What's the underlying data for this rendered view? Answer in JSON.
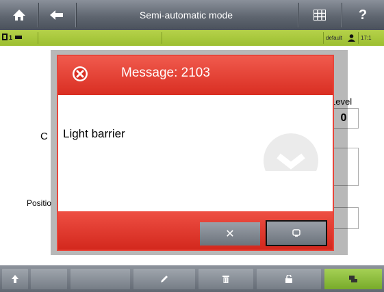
{
  "header": {
    "title": "Semi-automatic mode",
    "home_icon": "home-icon",
    "back_icon": "arrow-left-icon",
    "calc_icon": "calculator-icon",
    "help_label": "?"
  },
  "status": {
    "left_label": "1",
    "user": "default",
    "time": "17:1"
  },
  "background": {
    "level_label": "Level",
    "level_value": "0",
    "c_label": "C",
    "position_label": "Positio"
  },
  "dialog": {
    "title": "Message: 2103",
    "message": "Light barrier",
    "close_label": "✕",
    "close_icon": "close-circle-icon",
    "confirm_icon": "confirm-icon"
  },
  "toolbar": {
    "icons": [
      "arrow-up-icon",
      "pencil-icon",
      "trash-icon",
      "unlock-icon",
      "stamp-icon"
    ]
  },
  "colors": {
    "dialog_red": "#e0392d",
    "status_green": "#a9c83c",
    "accent_green": "#7fb626"
  }
}
